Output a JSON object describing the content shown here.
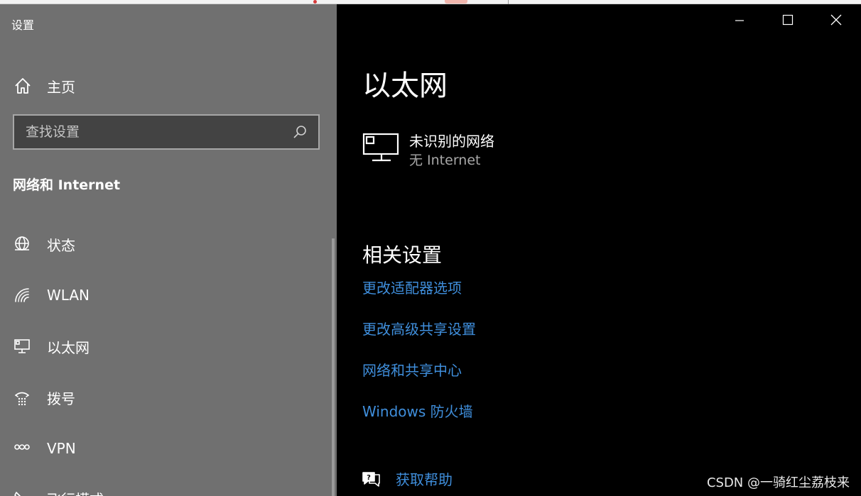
{
  "window": {
    "title": "设置",
    "controls": {
      "minimize": "minimize-icon",
      "maximize": "maximize-icon",
      "close": "close-icon"
    }
  },
  "sidebar": {
    "home_label": "主页",
    "search": {
      "placeholder": "查找设置",
      "value": ""
    },
    "section_title": "网络和 Internet",
    "items": [
      {
        "label": "状态",
        "icon": "globe-icon"
      },
      {
        "label": "WLAN",
        "icon": "wifi-icon"
      },
      {
        "label": "以太网",
        "icon": "ethernet-icon"
      },
      {
        "label": "拨号",
        "icon": "dialup-icon"
      },
      {
        "label": "VPN",
        "icon": "vpn-icon"
      },
      {
        "label": "飞行模式",
        "icon": "airplane-icon"
      }
    ]
  },
  "main": {
    "title": "以太网",
    "network": {
      "name": "未识别的网络",
      "status": "无 Internet"
    },
    "related_title": "相关设置",
    "links": [
      "更改适配器选项",
      "更改高级共享设置",
      "网络和共享中心",
      "Windows 防火墙"
    ],
    "help_label": "获取帮助"
  },
  "watermark": "CSDN @一骑红尘荔枝来",
  "colors": {
    "sidebar_bg": "#707070",
    "main_bg": "#000000",
    "link": "#3f8edb",
    "search_bg": "#434343"
  }
}
